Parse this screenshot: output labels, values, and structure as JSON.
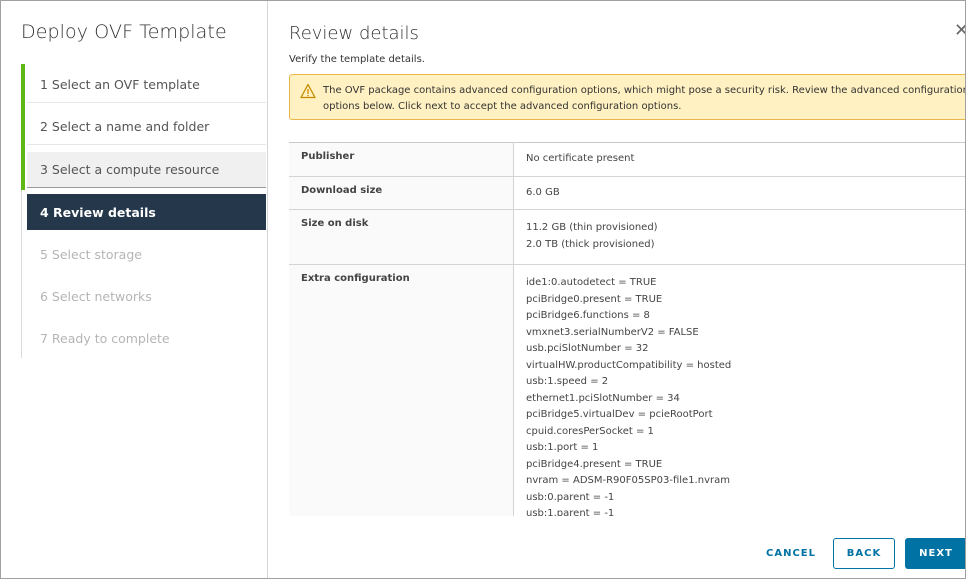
{
  "wizard": {
    "title": "Deploy OVF Template",
    "steps": [
      {
        "label": "1  Select an OVF template",
        "state": "done"
      },
      {
        "label": "2  Select a name and folder",
        "state": "done"
      },
      {
        "label": "3  Select a compute resource",
        "state": "done"
      },
      {
        "label": "4  Review details",
        "state": "active"
      },
      {
        "label": "5  Select storage",
        "state": "pending"
      },
      {
        "label": "6  Select networks",
        "state": "pending"
      },
      {
        "label": "7  Ready to complete",
        "state": "pending"
      }
    ]
  },
  "page": {
    "title": "Review details",
    "subtitle": "Verify the template details.",
    "close_icon": "close-icon"
  },
  "alert": {
    "icon": "warning-icon",
    "text": "The OVF package contains advanced configuration options, which might pose a security risk. Review the advanced configuration options below. Click next to accept the advanced configuration options."
  },
  "details": {
    "publisher_label": "Publisher",
    "publisher_value": "No certificate present",
    "download_label": "Download size",
    "download_value": "6.0 GB",
    "disk_label": "Size on disk",
    "disk_values": [
      "11.2 GB (thin provisioned)",
      "2.0 TB (thick provisioned)"
    ],
    "extra_label": "Extra configuration",
    "extra_values": [
      "ide1:0.autodetect = TRUE",
      "pciBridge0.present = TRUE",
      "pciBridge6.functions = 8",
      "vmxnet3.serialNumberV2 = FALSE",
      "usb.pciSlotNumber = 32",
      "virtualHW.productCompatibility = hosted",
      "usb:1.speed = 2",
      "ethernet1.pciSlotNumber = 34",
      "pciBridge5.virtualDev = pcieRootPort",
      "cpuid.coresPerSocket = 1",
      "usb:1.port = 1",
      "pciBridge4.present = TRUE",
      "nvram = ADSM-R90F05SP03-file1.nvram",
      "usb:0.parent = -1",
      "usb:1.parent = -1"
    ]
  },
  "footer": {
    "cancel_label": "CANCEL",
    "back_label": "BACK",
    "next_label": "NEXT"
  }
}
